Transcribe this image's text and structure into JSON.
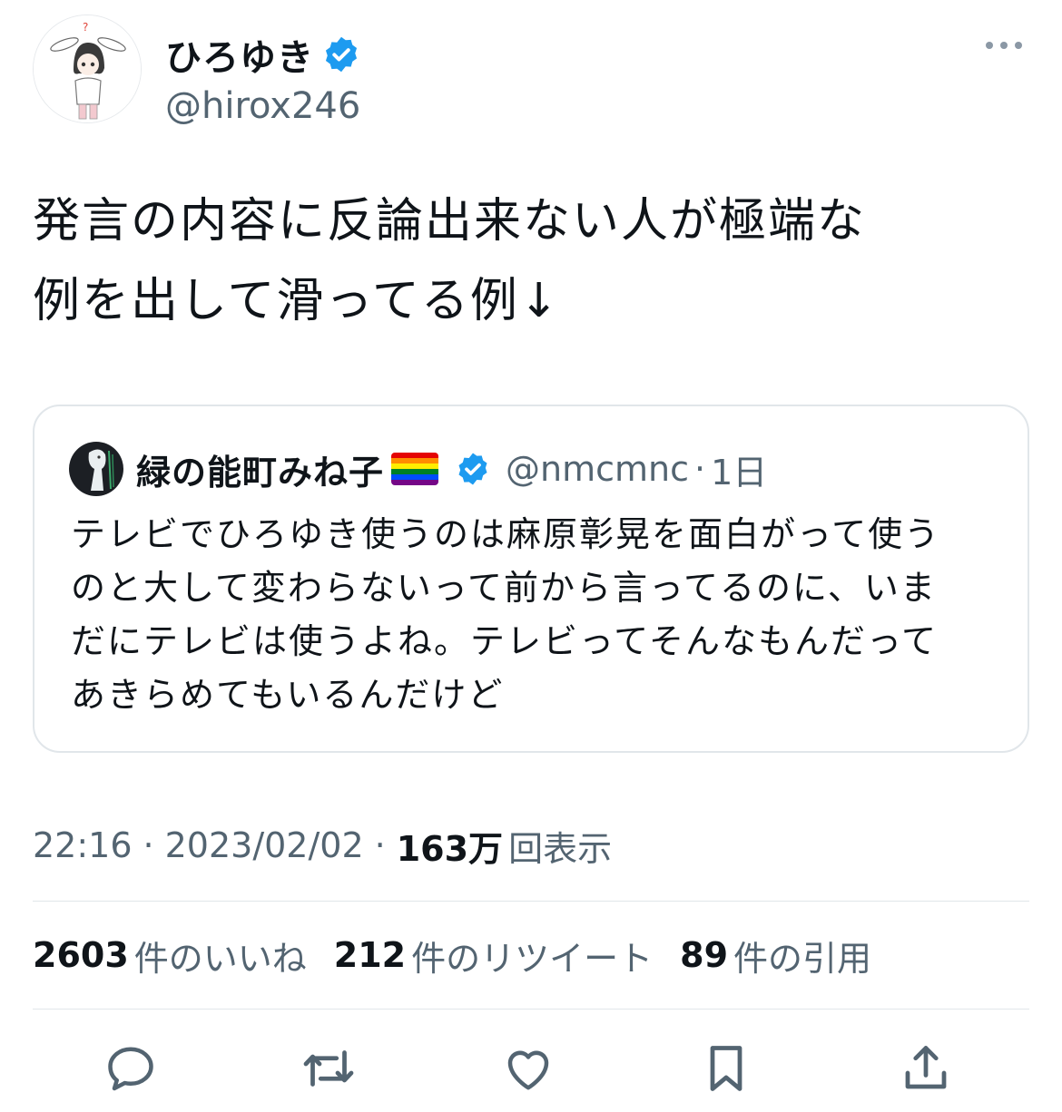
{
  "author": {
    "display_name": "ひろゆき",
    "handle": "@hirox246",
    "verified_color": "#1d9bf0"
  },
  "tweet": {
    "text_line1": "発言の内容に反論出来ない人が極端な",
    "text_line2": "例を出して滑ってる例↓"
  },
  "quoted_tweet": {
    "display_name": "緑の能町みね子",
    "flag": "rainbow-flag",
    "handle": "@nmcmnc",
    "separator": "·",
    "time": "1日",
    "lines": [
      "テレビでひろゆき使うのは麻原彰晃を面白がって使う",
      "のと大して変わらないって前から言ってるのに、いま",
      "だにテレビは使うよね。テレビってそんなもんだって",
      "あきらめてもいるんだけど"
    ]
  },
  "meta": {
    "time": "22:16",
    "separator": "·",
    "date": "2023/02/02",
    "views_count": "163万",
    "views_label": "回表示"
  },
  "stats": {
    "likes_count": "2603",
    "likes_label": "件のいいね",
    "retweets_count": "212",
    "retweets_label": "件のリツイート",
    "quotes_count": "89",
    "quotes_label": "件の引用"
  },
  "actions": {
    "icons": [
      "reply-icon",
      "retweet-icon",
      "like-icon",
      "bookmark-icon",
      "share-icon"
    ],
    "icon_color": "#536471"
  }
}
